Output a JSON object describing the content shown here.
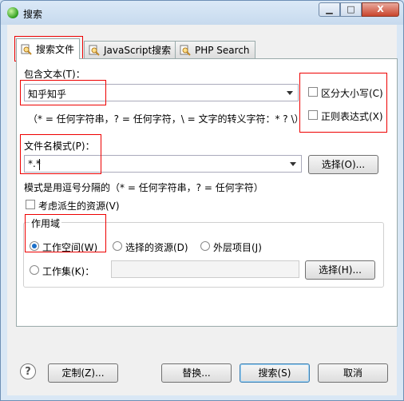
{
  "window": {
    "title": "搜索",
    "close_glyph": "X"
  },
  "tabs": [
    {
      "label": "搜索文件",
      "icon": "file-search-icon"
    },
    {
      "label": "JavaScript搜索",
      "icon": "js-search-icon"
    },
    {
      "label": "PHP Search",
      "icon": "php-search-icon"
    }
  ],
  "contains_text": {
    "label": "包含文本(T)：",
    "value": "知乎知乎",
    "hint": "（* = 任何字符串，? = 任何字符，\\ = 文字的转义字符：* ? \\）"
  },
  "options": {
    "case_sensitive": "区分大小写(C)",
    "regex": "正则表达式(X)"
  },
  "file_pattern": {
    "label": "文件名模式(P)：",
    "value": "*.*",
    "choose_button": "选择(O)...",
    "hint": "模式是用逗号分隔的（* = 任何字符串，? = 任何字符）",
    "derived": "考虑派生的资源(V)"
  },
  "scope": {
    "title": "作用域",
    "workspace": "工作空间(W)",
    "selected": "选择的资源(D)",
    "enclosing": "外层项目(J)",
    "working_set": "工作集(K)：",
    "choose_button": "选择(H)..."
  },
  "footer": {
    "help": "?",
    "customize": "定制(Z)...",
    "replace": "替换...",
    "search": "搜索(S)",
    "cancel": "取消"
  }
}
